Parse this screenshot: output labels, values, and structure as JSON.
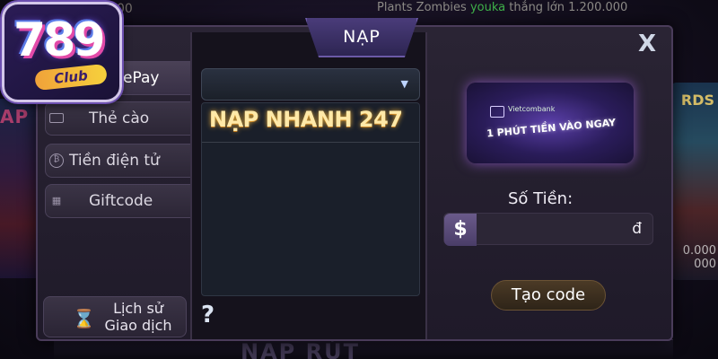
{
  "background": {
    "ticker_prefix": "Plants Zombies",
    "ticker_user": "youka",
    "ticker_suffix": "thắng lớn 1.200.000",
    "top_number": "00",
    "right_numbers": "0.000\n000",
    "bottom_text": "NAP  RÚT",
    "right_tile_text": "RDS",
    "left_tile_text": "AP R"
  },
  "logo": {
    "number": "789",
    "club": "Club"
  },
  "header": {
    "title": "NẠP"
  },
  "close_icon": "X",
  "sidebar": {
    "items": [
      {
        "label": "ePay",
        "icon": "epay-icon",
        "active": true
      },
      {
        "label": "Thẻ cào",
        "icon": "card-icon",
        "active": false
      },
      {
        "label": "Tiền điện tử",
        "icon": "bitcoin-icon",
        "active": false
      },
      {
        "label": "Giftcode",
        "icon": "gift-icon",
        "active": false
      }
    ],
    "history": {
      "line1": "Lịch sử",
      "line2": "Giao dịch",
      "icon": "hourglass-icon"
    }
  },
  "center": {
    "dropdown_value": "",
    "options": [
      "NẠP NHANH 247"
    ],
    "help_icon": "?"
  },
  "right": {
    "banner_bank": "Vietcombank",
    "banner_text": "1 PHÚT TIỀN VÀO NGAY",
    "amount_label": "Số Tiền:",
    "currency_symbol": "$",
    "amount_value": "",
    "amount_unit": "đ",
    "create_button": "Tạo code"
  },
  "colors": {
    "modal_bg": "#211b2b",
    "accent_purple": "#4a3c7a",
    "highlight_gold": "#ffe9a8",
    "ticker_green": "#3fb24a"
  }
}
